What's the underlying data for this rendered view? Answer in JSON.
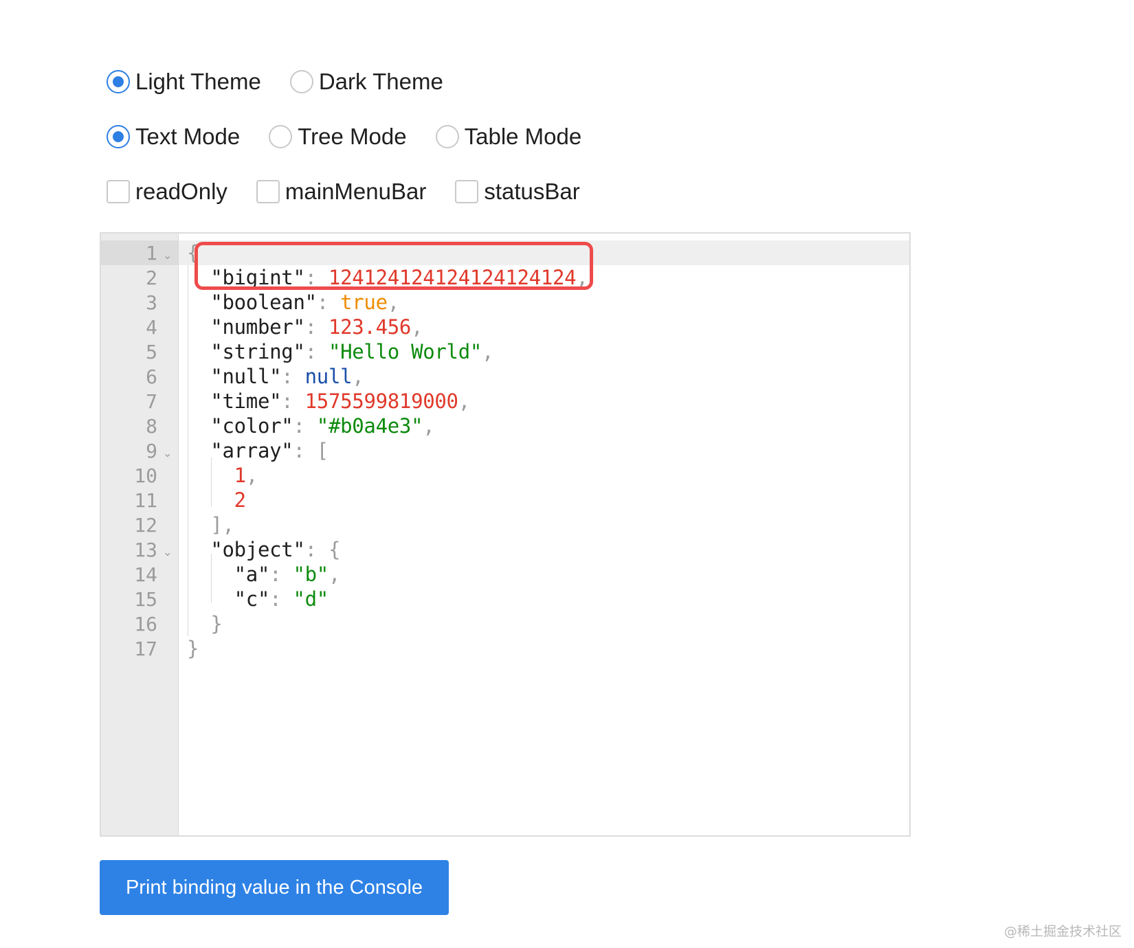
{
  "theme_options": [
    {
      "label": "Light Theme",
      "selected": true
    },
    {
      "label": "Dark Theme",
      "selected": false
    }
  ],
  "mode_options": [
    {
      "label": "Text Mode",
      "selected": true
    },
    {
      "label": "Tree Mode",
      "selected": false
    },
    {
      "label": "Table Mode",
      "selected": false
    }
  ],
  "flags": [
    {
      "label": "readOnly",
      "checked": false
    },
    {
      "label": "mainMenuBar",
      "checked": false
    },
    {
      "label": "statusBar",
      "checked": false
    }
  ],
  "editor": {
    "line_numbers": [
      "1",
      "2",
      "3",
      "4",
      "5",
      "6",
      "7",
      "8",
      "9",
      "10",
      "11",
      "12",
      "13",
      "14",
      "15",
      "16",
      "17"
    ],
    "foldable_lines": [
      "1",
      "9",
      "13"
    ],
    "lines": [
      "{",
      "  \"bigint\": 124124124124124124124,",
      "  \"boolean\": true,",
      "  \"number\": 123.456,",
      "  \"string\": \"Hello World\",",
      "  \"null\": null,",
      "  \"time\": 1575599819000,",
      "  \"color\": \"#b0a4e3\",",
      "  \"array\": [",
      "    1,",
      "    2",
      "  ],",
      "  \"object\": {",
      "    \"a\": \"b\",",
      "    \"c\": \"d\"",
      "  }",
      "}"
    ]
  },
  "print_button_label": "Print binding value in the Console",
  "watermark": "@稀土掘金技术社区",
  "colors": {
    "accent": "#2d7fe3",
    "number": "#e0392b",
    "string": "#0c8a0c",
    "boolean": "#ee8c00",
    "null": "#1a4fa8",
    "highlight_border": "#ee4b4b"
  }
}
